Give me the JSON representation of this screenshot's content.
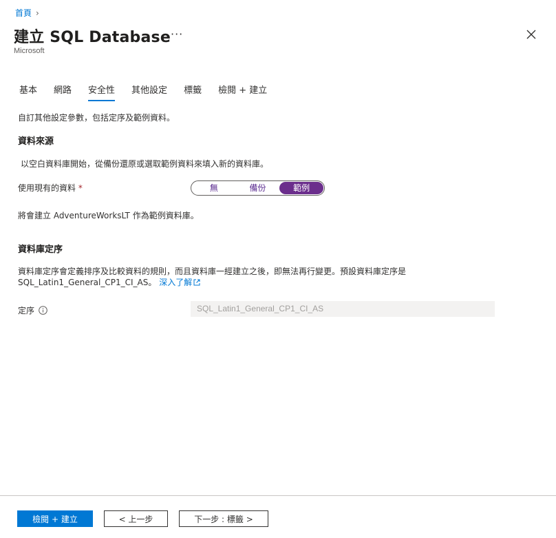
{
  "breadcrumb": {
    "home": "首頁"
  },
  "header": {
    "title": "建立 SQL Database",
    "more": "···",
    "subtitle": "Microsoft"
  },
  "tabs": [
    {
      "label": "基本",
      "active": false
    },
    {
      "label": "網路",
      "active": false
    },
    {
      "label": "安全性",
      "active": true
    },
    {
      "label": "其他設定",
      "active": false
    },
    {
      "label": "標籤",
      "active": false
    },
    {
      "label": "檢閱 + 建立",
      "active": false
    }
  ],
  "main": {
    "description": "自訂其他設定參數，包括定序及範例資料。",
    "data_source": {
      "heading": "資料來源",
      "description": "以空白資料庫開始，從備份還原或選取範例資料來填入新的資料庫。",
      "field_label": "使用現有的資料",
      "required_mark": "*",
      "options": [
        "無",
        "備份",
        "範例"
      ],
      "selected": "範例",
      "note": "將會建立 AdventureWorksLT 作為範例資料庫。"
    },
    "collation": {
      "heading": "資料庫定序",
      "description": "資料庫定序會定義排序及比較資料的規則，而且資料庫一經建立之後，即無法再行變更。預設資料庫定序是 SQL_Latin1_General_CP1_CI_AS。",
      "learn_more": "深入了解",
      "field_label": "定序",
      "value": "SQL_Latin1_General_CP1_CI_AS"
    }
  },
  "footer": {
    "review_create": "檢閱 + 建立",
    "previous": "< 上一步",
    "next": "下一步 : 標籤 >"
  },
  "colors": {
    "accent": "#0078d4",
    "toggle_selected": "#6b2e8c",
    "required": "#a4262c"
  }
}
